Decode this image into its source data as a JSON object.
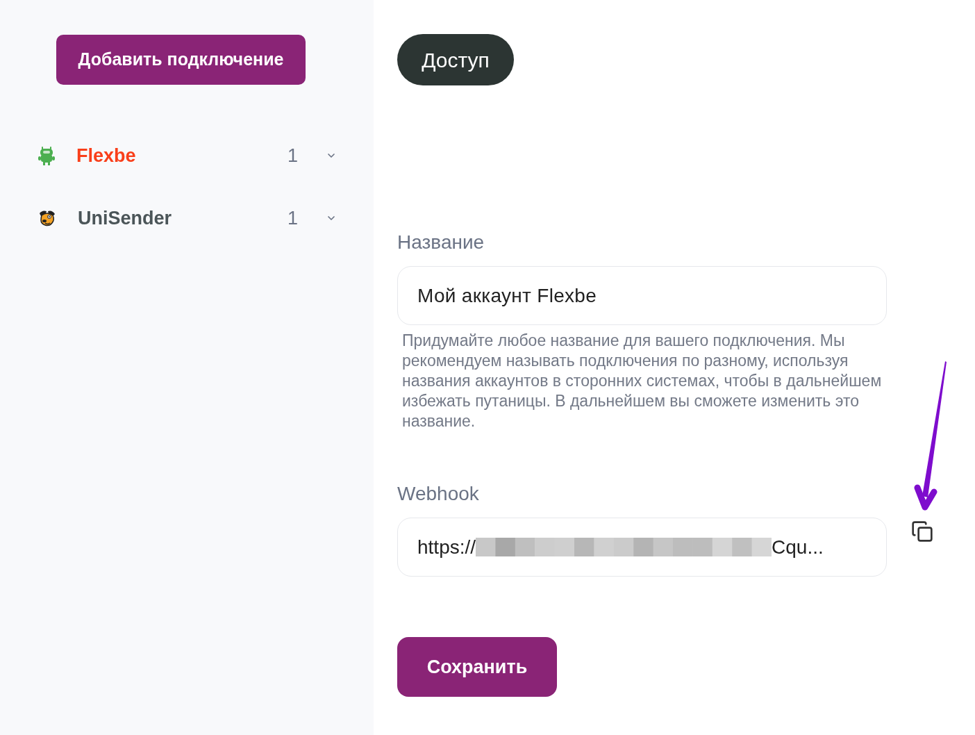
{
  "sidebar": {
    "add_button": "Добавить подключение",
    "items": [
      {
        "name": "Flexbe",
        "count": "1",
        "selected": true,
        "expanded": false
      },
      {
        "name": "UniSender",
        "count": "1",
        "selected": false,
        "expanded": false
      }
    ]
  },
  "main": {
    "access_button": "Доступ",
    "name_field": {
      "label": "Название",
      "value": "Мой аккаунт Flexbe",
      "hint": "Придумайте любое название для вашего подключения. Мы рекомендуем называть подключения по разному, используя названия аккаунтов в сторонних системах, чтобы в дальнейшем избежать путаницы. В дальнейшем вы сможете изменить это название."
    },
    "webhook_field": {
      "label": "Webhook",
      "value_start": "https://",
      "redacted": true,
      "value_end": "Cqu..."
    },
    "save_button": "Сохранить",
    "annotations": [
      {
        "kind": "arrow"
      }
    ]
  }
}
